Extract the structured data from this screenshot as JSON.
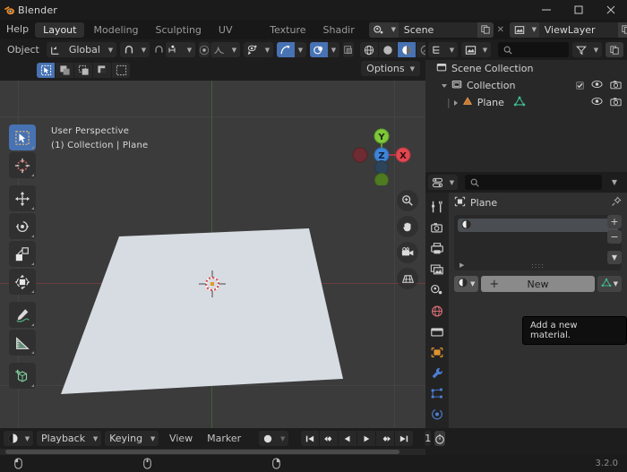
{
  "window": {
    "title": "Blender",
    "app_icon": "blender-logo-icon",
    "minimize": "–",
    "maximize": "□",
    "close": "✕"
  },
  "topbar": {
    "menus": [
      "Help"
    ],
    "workspace_tabs": [
      {
        "label": "Layout",
        "active": true
      },
      {
        "label": "Modeling",
        "active": false
      },
      {
        "label": "Sculpting",
        "active": false
      },
      {
        "label": "UV Editing",
        "active": false
      },
      {
        "label": "Texture Paint",
        "active": false
      },
      {
        "label": "Shadir",
        "active": false
      }
    ],
    "scene": {
      "name": "Scene",
      "icon": "scene-icon",
      "copy_icon": "duplicate-icon",
      "unlink": "✕"
    },
    "view_layer": {
      "name": "ViewLayer",
      "icon": "viewlayer-icon",
      "copy_icon": "duplicate-icon",
      "unlink": "✕"
    }
  },
  "viewport": {
    "mode": "Object",
    "transform_orientation": "Global",
    "snap_icon": "magnet-icon",
    "proportional_icon": "proportional-edit-icon",
    "overlay_label": "Options",
    "info_line1": "User Perspective",
    "info_line2": "(1) Collection | Plane",
    "gizmo": {
      "x": "X",
      "y": "Y",
      "z": "Z",
      "x_color": "#e0474f",
      "y_color": "#7ec73a",
      "z_color": "#3e84d8"
    },
    "select_modes": [
      "select-box-icon",
      "select-new-icon",
      "select-extend-icon",
      "select-subtract-icon",
      "select-difference-icon"
    ],
    "shading_modes": [
      "wireframe-icon",
      "solid-icon",
      "material-preview-icon",
      "rendered-icon"
    ],
    "side_buttons": [
      "zoom-icon",
      "pan-hand-icon",
      "camera-view-icon",
      "ortho-perspective-icon"
    ],
    "toolbar": [
      {
        "name": "tweak-select-box-tool",
        "active": true
      },
      {
        "name": "cursor-tool",
        "active": false
      },
      {
        "name": "move-tool",
        "active": false
      },
      {
        "name": "rotate-tool",
        "active": false
      },
      {
        "name": "scale-tool",
        "active": false
      },
      {
        "name": "transform-tool",
        "active": false
      },
      {
        "name": "annotate-tool",
        "active": false
      },
      {
        "name": "measure-tool",
        "active": false
      },
      {
        "name": "add-cube-tool",
        "active": false
      }
    ]
  },
  "outliner": {
    "display_mode_icon": "outliner-icon",
    "filter_icon": "filter-icon",
    "search_placeholder": "",
    "search_value": "",
    "rows": [
      {
        "name": "Scene Collection",
        "icon": "scene-collection-icon",
        "depth": 0,
        "expander": "",
        "checkbox": false,
        "eye": false,
        "camera": false
      },
      {
        "name": "Collection",
        "icon": "collection-icon",
        "depth": 1,
        "expander": "down",
        "checkbox": true,
        "eye": true,
        "camera": true
      },
      {
        "name": "Plane",
        "icon": "mesh-data-icon",
        "depth": 2,
        "expander": "right",
        "checkbox": false,
        "eye": true,
        "camera": true
      }
    ]
  },
  "properties": {
    "editor_icon": "properties-icon",
    "search_value": "",
    "breadcrumb": "Plane",
    "breadcrumb_icon": "object-icon",
    "pin_icon": "pin-icon",
    "tabs": [
      {
        "name": "tool-tab",
        "glyph": "tool",
        "active": false
      },
      {
        "name": "render-tab",
        "glyph": "render",
        "active": false
      },
      {
        "name": "output-tab",
        "glyph": "output",
        "active": false
      },
      {
        "name": "view-layer-tab",
        "glyph": "viewlayer",
        "active": false
      },
      {
        "name": "scene-tab",
        "glyph": "scene",
        "active": false
      },
      {
        "name": "world-tab",
        "glyph": "world",
        "active": false
      },
      {
        "name": "collection-tab",
        "glyph": "collection",
        "active": false
      },
      {
        "name": "object-tab",
        "glyph": "object",
        "active": false
      },
      {
        "name": "modifier-tab",
        "glyph": "wrench",
        "active": false
      },
      {
        "name": "particles-tab",
        "glyph": "particles",
        "active": false
      },
      {
        "name": "physics-tab",
        "glyph": "physics",
        "active": false
      }
    ],
    "material_slots": {
      "slot_icon": "material-sphere-icon",
      "slot_name": "",
      "add_slot": "+",
      "remove_slot": "−",
      "specials": "⌄",
      "expand_arrow": "▶",
      "grip": "::::"
    },
    "new_material": {
      "browse_icon": "material-sphere-icon",
      "plus": "+",
      "label": "New",
      "data_icon": "mesh-data-icon"
    },
    "tooltip": "Add a new material."
  },
  "timeline": {
    "editor_icon": "timeline-icon",
    "menus": [
      "Playback",
      "Keying",
      "View",
      "Marker"
    ],
    "record_icon": "record-dot-icon",
    "transport": [
      "jump-to-start-icon",
      "prev-keyframe-icon",
      "play-reverse-icon",
      "play-icon",
      "next-keyframe-icon",
      "jump-to-end-icon"
    ],
    "current_frame": "1",
    "autokey_icon": "stopwatch-icon",
    "sync_icon": "sync-icon"
  },
  "statusbar": {
    "hints": [
      {
        "icon": "mouse-left-icon",
        "label": ""
      },
      {
        "icon": "mouse-middle-icon",
        "label": ""
      },
      {
        "icon": "mouse-right-icon",
        "label": ""
      }
    ],
    "version": "3.2.0"
  }
}
